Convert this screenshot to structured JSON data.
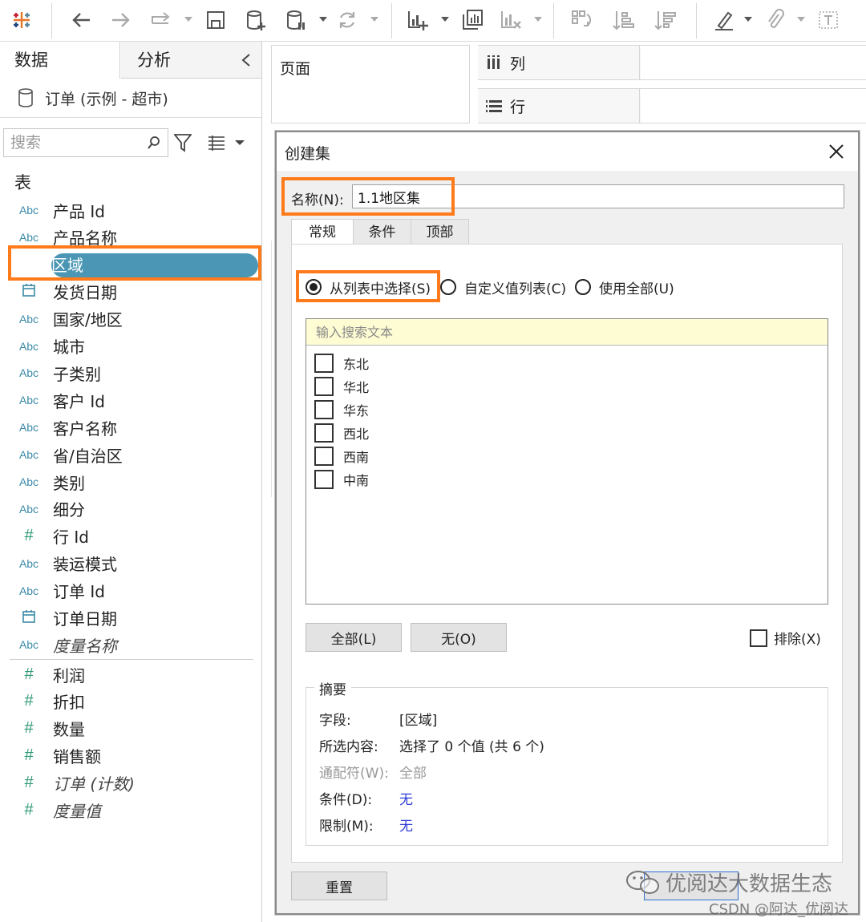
{
  "toolbar": {
    "icons": [
      "tableau-logo-icon",
      "undo-icon",
      "redo-icon",
      "forward-icon",
      "save-icon",
      "new-datasource-icon",
      "paused-datasource-icon",
      "refresh-icon",
      "new-sheet-icon",
      "duplicate-sheet-icon",
      "clear-sheet-icon",
      "swap-icon",
      "sort-ascending-icon",
      "sort-descending-icon",
      "highlight-icon",
      "attach-icon",
      "label-icon"
    ]
  },
  "left_panel": {
    "tabs": {
      "data": "数据",
      "analysis": "分析"
    },
    "datasource": "订单 (示例 - 超市)",
    "search_placeholder": "搜索",
    "tables_title": "表",
    "dimensions": [
      {
        "type": "Abc",
        "name": "产品 Id"
      },
      {
        "type": "Abc",
        "name": "产品名称"
      },
      {
        "type": "Abc",
        "name": "区域"
      },
      {
        "type": "date",
        "name": "发货日期"
      },
      {
        "type": "Abc",
        "name": "国家/地区"
      },
      {
        "type": "Abc",
        "name": "城市"
      },
      {
        "type": "Abc",
        "name": "子类别"
      },
      {
        "type": "Abc",
        "name": "客户 Id"
      },
      {
        "type": "Abc",
        "name": "客户名称"
      },
      {
        "type": "Abc",
        "name": "省/自治区"
      },
      {
        "type": "Abc",
        "name": "类别"
      },
      {
        "type": "Abc",
        "name": "细分"
      },
      {
        "type": "#",
        "name": "行 Id"
      },
      {
        "type": "Abc",
        "name": "装运模式"
      },
      {
        "type": "Abc",
        "name": "订单 Id"
      },
      {
        "type": "date",
        "name": "订单日期"
      },
      {
        "type": "Abc",
        "name": "度量名称"
      }
    ],
    "measures": [
      {
        "type": "#",
        "name": "利润"
      },
      {
        "type": "#",
        "name": "折扣"
      },
      {
        "type": "#",
        "name": "数量"
      },
      {
        "type": "#",
        "name": "销售额"
      },
      {
        "type": "#",
        "name": "订单 (计数)"
      },
      {
        "type": "#",
        "name": "度量值"
      }
    ]
  },
  "shelves": {
    "pages": "页面",
    "columns": "列",
    "rows": "行"
  },
  "dialog": {
    "title": "创建集",
    "name_label": "名称(N):",
    "name_value": "1.1地区集",
    "tabs": [
      "常规",
      "条件",
      "顶部"
    ],
    "radio_options": [
      "从列表中选择(S)",
      "自定义值列表(C)",
      "使用全部(U)"
    ],
    "list_search_placeholder": "输入搜索文本",
    "items": [
      "东北",
      "华北",
      "华东",
      "西北",
      "西南",
      "中南"
    ],
    "btn_all": "全部(L)",
    "btn_none": "无(O)",
    "exclude_label": "排除(X)",
    "summary": {
      "legend": "摘要",
      "rows": [
        {
          "key": "字段:",
          "value": "[区域]"
        },
        {
          "key": "所选内容:",
          "value": "选择了 0 个值 (共 6 个)"
        },
        {
          "key": "通配符(W):",
          "value": "全部"
        },
        {
          "key": "条件(D):",
          "value": "无"
        },
        {
          "key": "限制(M):",
          "value": "无"
        }
      ]
    },
    "btn_reset": "重置"
  },
  "watermark": {
    "line1": "优阅达大数据生态",
    "line2": "CSDN @阿达_优阅达"
  },
  "colors": {
    "highlight": "#ff7a1a",
    "selected_pill": "#4a96b4",
    "dim_type": "#3a8aa6",
    "measure_type": "#2f9a74"
  }
}
